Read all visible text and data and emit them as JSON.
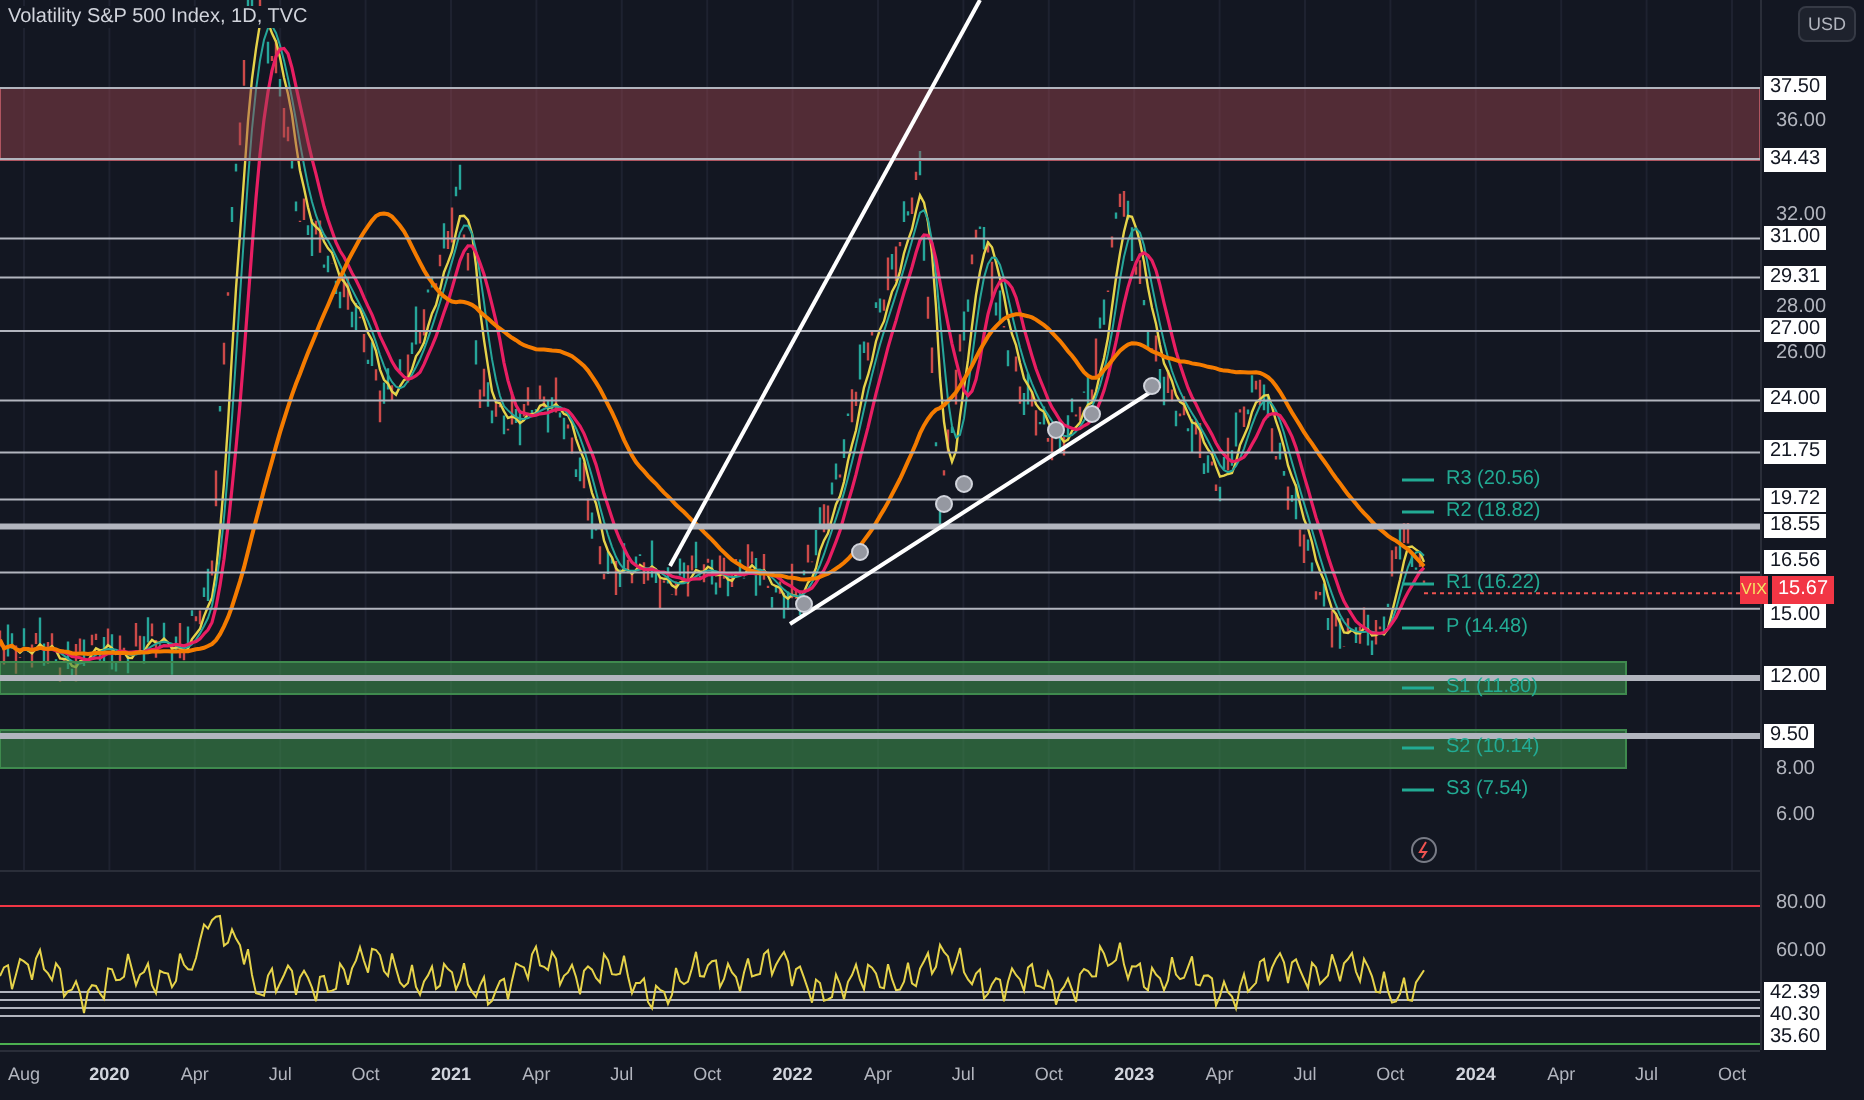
{
  "header": {
    "title": "Volatility S&P 500 Index, 1D, TVC",
    "currency_button": "USD"
  },
  "price_axis": {
    "ticks": [
      "36.00",
      "32.00",
      "28.00",
      "26.00",
      "8.00",
      "6.00"
    ],
    "levels": [
      "37.50",
      "34.43",
      "31.00",
      "29.31",
      "27.00",
      "24.00",
      "21.75",
      "19.72",
      "18.55",
      "16.56",
      "15.00",
      "12.00",
      "9.50"
    ]
  },
  "last_price": {
    "symbol": "VIX",
    "value": "15.67"
  },
  "pivots": [
    "R3 (20.56)",
    "R2 (18.82)",
    "R1 (16.22)",
    "P (14.48)",
    "S1 (11.80)",
    "S2 (10.14)",
    "S3 (7.54)"
  ],
  "rsi_axis": {
    "ticks": [
      "80.00",
      "60.00"
    ],
    "levels": [
      "42.39",
      "40.30",
      "35.60"
    ]
  },
  "time_axis": [
    {
      "label": "Aug",
      "kind": "month"
    },
    {
      "label": "2020",
      "kind": "year"
    },
    {
      "label": "Apr",
      "kind": "month"
    },
    {
      "label": "Jul",
      "kind": "month"
    },
    {
      "label": "Oct",
      "kind": "month"
    },
    {
      "label": "2021",
      "kind": "year"
    },
    {
      "label": "Apr",
      "kind": "month"
    },
    {
      "label": "Jul",
      "kind": "month"
    },
    {
      "label": "Oct",
      "kind": "month"
    },
    {
      "label": "2022",
      "kind": "year"
    },
    {
      "label": "Apr",
      "kind": "month"
    },
    {
      "label": "Jul",
      "kind": "month"
    },
    {
      "label": "Oct",
      "kind": "month"
    },
    {
      "label": "2023",
      "kind": "year"
    },
    {
      "label": "Apr",
      "kind": "month"
    },
    {
      "label": "Jul",
      "kind": "month"
    },
    {
      "label": "Oct",
      "kind": "month"
    },
    {
      "label": "2024",
      "kind": "year"
    },
    {
      "label": "Apr",
      "kind": "month"
    },
    {
      "label": "Jul",
      "kind": "month"
    },
    {
      "label": "Oct",
      "kind": "month"
    }
  ]
}
